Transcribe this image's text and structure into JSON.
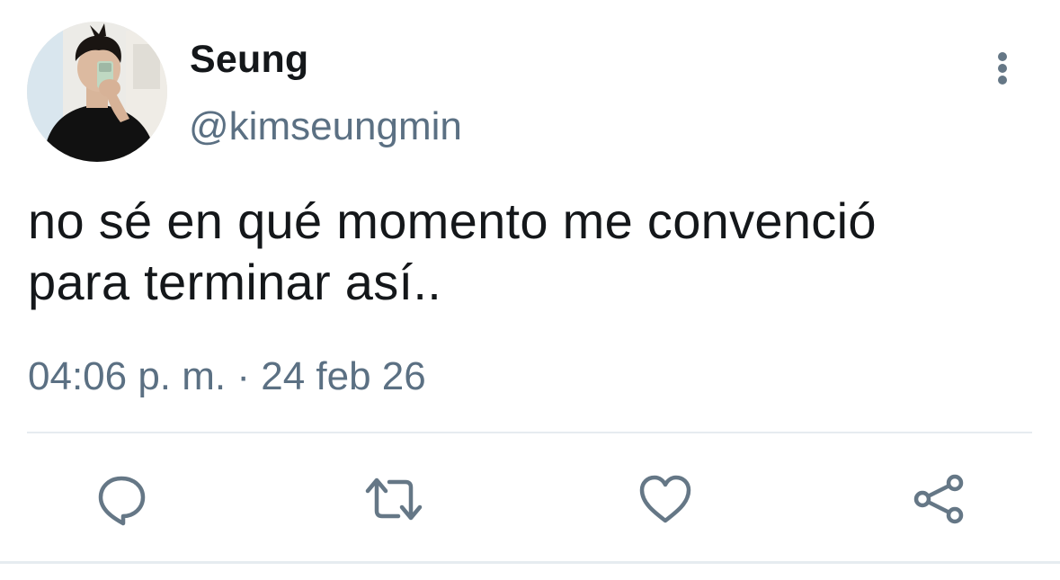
{
  "tweet": {
    "display_name": "Seung",
    "handle": "@kimseungmin",
    "text_lines": [
      "no sé en qué momento me convenció",
      "para terminar así.."
    ],
    "timestamp": "04:06 p. m. · 24 feb 26"
  },
  "actions": {
    "icons": [
      "reply-icon",
      "retweet-icon",
      "like-icon",
      "share-icon"
    ]
  },
  "colors": {
    "text": "#14171a",
    "secondary": "#5b7083",
    "icon": "#657786",
    "divider": "#e6ecf0"
  }
}
